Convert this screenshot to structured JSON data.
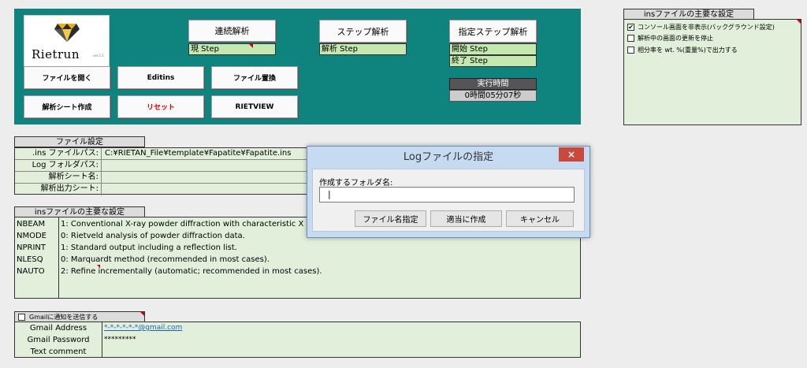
{
  "app": {
    "logo_text": "Rietrun",
    "logo_version": "ver.2.1"
  },
  "panel": {
    "open_file": "ファイルを開く",
    "editins": "Editins",
    "replace_file": "ファイル置換",
    "create_sheet": "解析シート作成",
    "reset": "リセット",
    "rietview": "RIETVIEW",
    "continuous": "連続解析",
    "current_step": "現 Step",
    "step_analysis": "ステップ解析",
    "analysis_step": "解析 Step",
    "specified_step": "指定ステップ解析",
    "start_step": "開始 Step",
    "end_step": "終了 Step",
    "exec_time_label": "実行時間",
    "exec_time_value": "0時間05分07秒"
  },
  "right_settings": {
    "title": "insファイルの主要な設定",
    "options": [
      {
        "label": "コンソール画面を非表示(バックグラウンド設定)",
        "checked": "✔"
      },
      {
        "label": "解析中の画面の更新を停止",
        "checked": ""
      },
      {
        "label": "相分率を wt. %(重量%)で出力する",
        "checked": ""
      }
    ]
  },
  "file_settings": {
    "title": "ファイル設定",
    "rows": [
      {
        "label": ".ins ファイルパス:",
        "value": "C:¥RIETAN_File¥template¥Fapatite¥Fapatite.ins"
      },
      {
        "label": "Log フォルダパス:",
        "value": ""
      },
      {
        "label": "解析シート名:",
        "value": ""
      },
      {
        "label": "解析出力シート:",
        "value": ""
      }
    ]
  },
  "ins_settings": {
    "title": "insファイルの主要な設定",
    "rows": [
      {
        "key": "NBEAM",
        "value": "1: Conventional X-ray powder diffraction with characteristic X rays"
      },
      {
        "key": "NMODE",
        "value": "0: Rietveld analysis of powder diffraction data."
      },
      {
        "key": "NPRINT",
        "value": "1: Standard output including a reflection list."
      },
      {
        "key": "NLESQ",
        "value": "0: Marquardt method (recommended in most cases)."
      },
      {
        "key": "NAUTO",
        "value": "2: Refine incrementally (automatic; recommended in most cases)."
      }
    ]
  },
  "gmail": {
    "checkbox_label": "Gmailに通知を送信する",
    "address_label": "Gmail Address",
    "address_value": "*-*-*-*-*-*@gmail.com",
    "password_label": "Gmail Password",
    "password_value": "*********",
    "comment_label": "Text comment",
    "link_color": "#1f5fbf"
  },
  "dialog": {
    "title": "Logファイルの指定",
    "close": "×",
    "folder_label": "作成するフォルダ名:",
    "folder_value": "",
    "btn_specify": "ファイル名指定",
    "btn_auto": "適当に作成",
    "btn_cancel": "キャンセル"
  },
  "colors": {
    "panel": "#0f847f",
    "cell_green": "#e2efda",
    "step_green": "#c3e8b0",
    "dialog_frame": "#c6daf1",
    "close_red": "#c94a3c"
  }
}
